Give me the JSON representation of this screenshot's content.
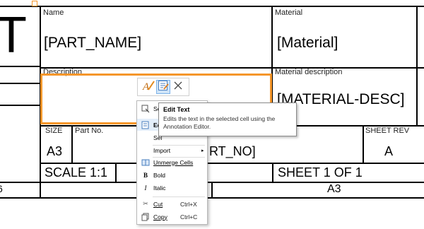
{
  "title_block": {
    "corner_glyph": "T",
    "name_label": "Name",
    "name_value": "[PART_NAME]",
    "material_label": "Material",
    "material_value": "[Material]",
    "description_label": "Description",
    "material_desc_label": "Material description",
    "material_desc_value": "[MATERIAL-DESC]",
    "size_label": "SIZE",
    "size_value": "A3",
    "part_no_label": "Part No.",
    "part_no_value": "RT_NO]",
    "sheet_rev_label": "SHEET REV",
    "sheet_rev_value": "A",
    "scale_value": "SCALE 1:1",
    "sheet_value": "SHEET 1 OF 1",
    "bottom_left_fragment": "6",
    "bottom_size": "A3"
  },
  "mini_toolbar": {
    "icons": [
      "text-style-icon",
      "edit-text-icon",
      "close-icon"
    ]
  },
  "context_menu": {
    "items": [
      {
        "label": "Select",
        "visible": "Se"
      },
      {
        "label": "Edit Text",
        "visible": "Edi"
      },
      {
        "label": "Select",
        "visible": "Sel"
      },
      {
        "label": "Import",
        "visible": "Import"
      },
      {
        "label": "Unmerge Cells",
        "visible": "Unmerge Cells"
      },
      {
        "label": "Bold",
        "visible": "Bold"
      },
      {
        "label": "Italic",
        "visible": "Italic"
      },
      {
        "label": "Cut",
        "visible": "Cut",
        "shortcut": "Ctrl+X"
      },
      {
        "label": "Copy",
        "visible": "Copy",
        "shortcut": "Ctrl+C"
      }
    ]
  },
  "tooltip": {
    "title": "Edit Text",
    "body": "Edits the text in the selected cell using the Annotation Editor."
  },
  "colors": {
    "selection": "#f5962a",
    "hover": "#e3eefa",
    "active_button": "#cfe4f7"
  }
}
